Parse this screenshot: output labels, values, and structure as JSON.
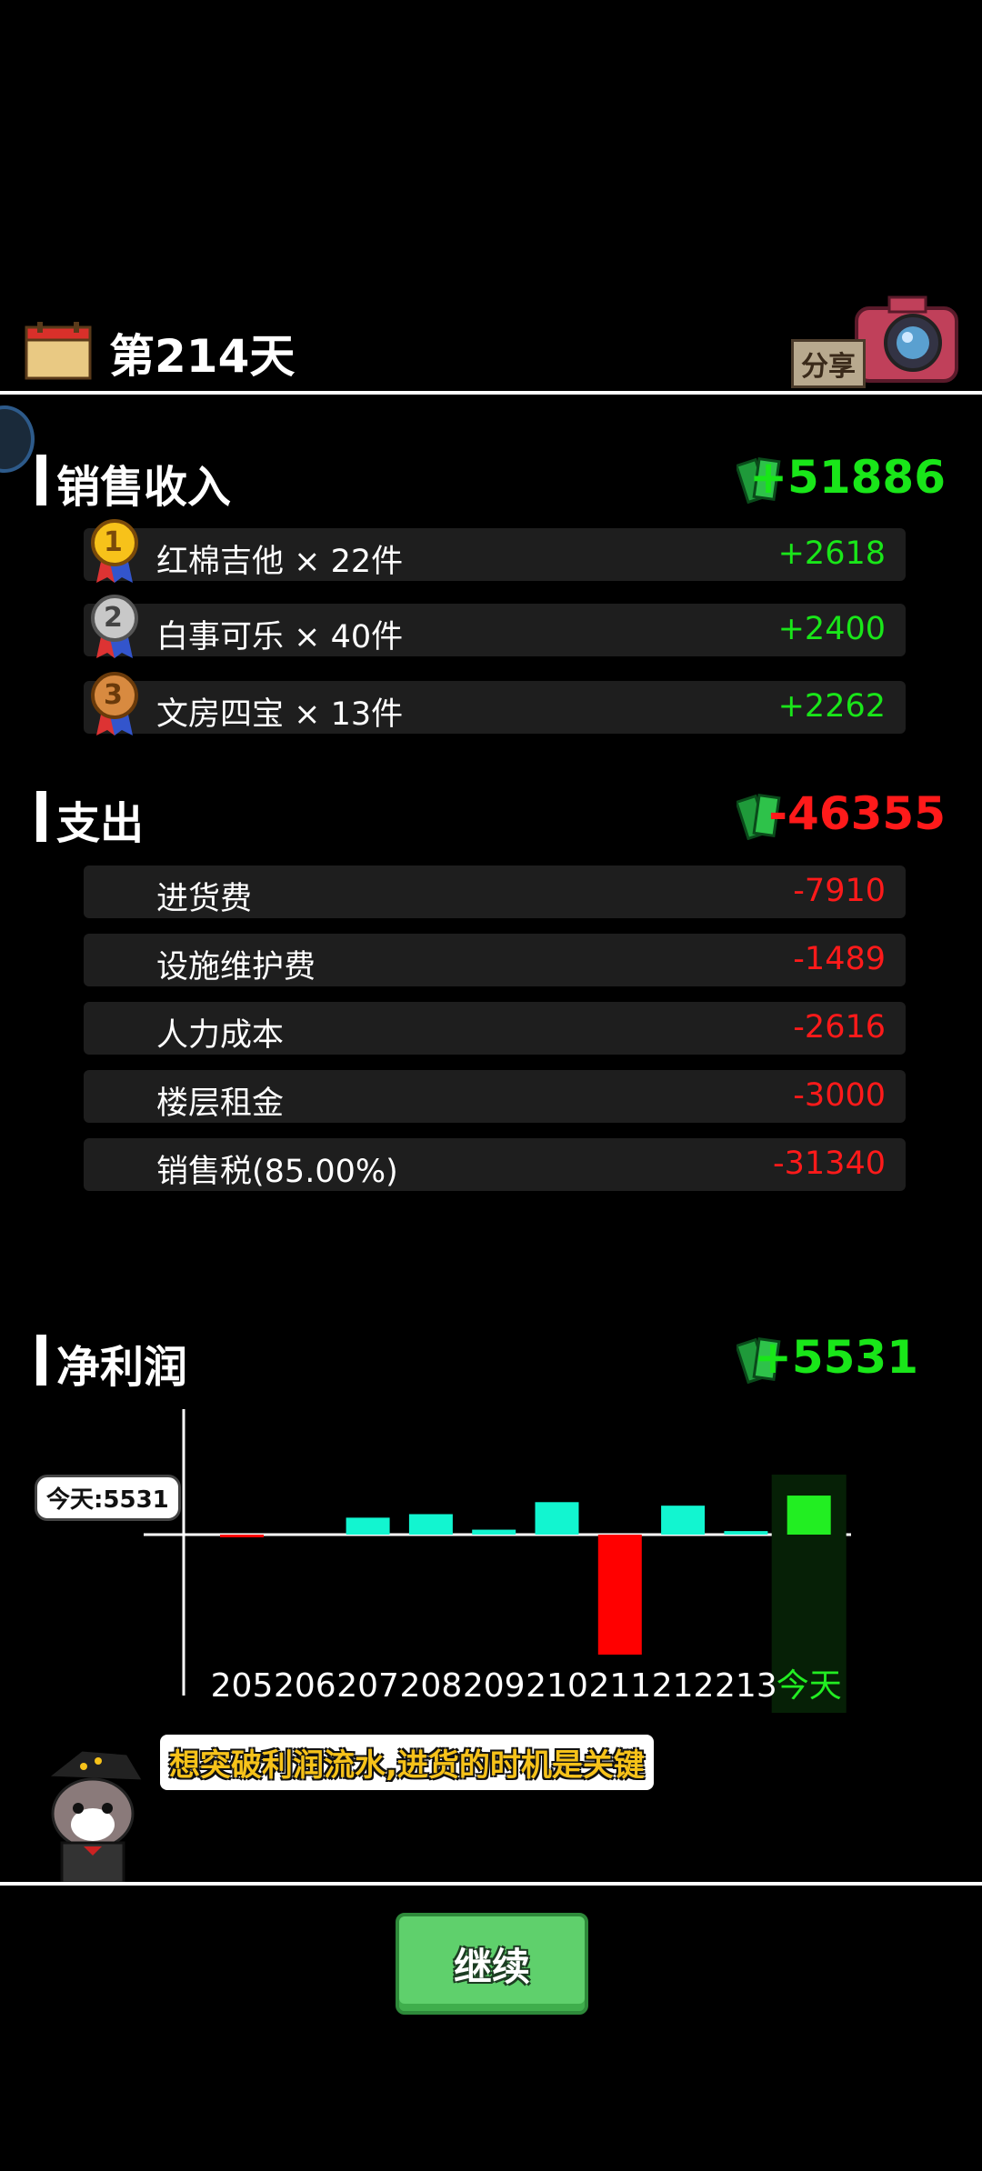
{
  "header": {
    "day_title": "第214天",
    "share_label": "分享"
  },
  "income": {
    "title": "销售收入",
    "total": "+51886",
    "items": [
      {
        "rank": "1",
        "label": "红棉吉他 × 22件",
        "value": "+2618"
      },
      {
        "rank": "2",
        "label": "白事可乐 × 40件",
        "value": "+2400"
      },
      {
        "rank": "3",
        "label": "文房四宝 × 13件",
        "value": "+2262"
      }
    ]
  },
  "expense": {
    "title": "支出",
    "total": "-46355",
    "items": [
      {
        "label": "进货费",
        "value": "-7910"
      },
      {
        "label": "设施维护费",
        "value": "-1489"
      },
      {
        "label": "人力成本",
        "value": "-2616"
      },
      {
        "label": "楼层租金",
        "value": "-3000"
      },
      {
        "label": "销售税(85.00%)",
        "value": "-31340"
      }
    ]
  },
  "profit": {
    "title": "净利润",
    "total": "+5531"
  },
  "chart_data": {
    "type": "bar",
    "categories": [
      "205",
      "206",
      "207",
      "208",
      "209",
      "210",
      "211",
      "212",
      "213",
      "今天"
    ],
    "values": [
      -200,
      0,
      2400,
      2900,
      700,
      4600,
      -17000,
      4100,
      500,
      5531
    ],
    "highlight": "今天",
    "tag": "今天:5531",
    "colors": {
      "positive": "#12f5d0",
      "negative": "#ff0000",
      "today": "#22ee22"
    }
  },
  "tip": {
    "text": "想突破利润流水,进货的时机是关键"
  },
  "continue_button": {
    "label": "继续"
  }
}
